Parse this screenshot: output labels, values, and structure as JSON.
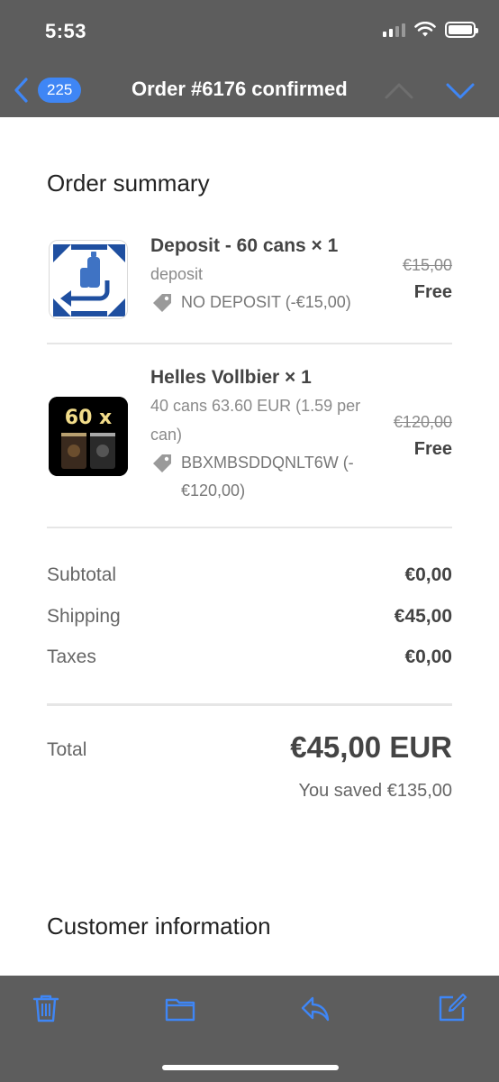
{
  "status_bar": {
    "time": "5:53"
  },
  "nav": {
    "badge": "225",
    "title": "Order #6176 confirmed"
  },
  "order_summary": {
    "title": "Order summary",
    "items": [
      {
        "name": "Deposit - 60 cans × 1",
        "subtitle": "deposit",
        "discount": "NO DEPOSIT (-€15,00)",
        "original_price": "€15,00",
        "price": "Free",
        "icon": "return-bottle-icon"
      },
      {
        "name": "Helles Vollbier × 1",
        "subtitle": "40 cans 63.60 EUR (1.59 per can)",
        "discount": "BBXMBSDDQNLT6W (-€120,00)",
        "original_price": "€120,00",
        "price": "Free",
        "thumb_text": "60 x"
      }
    ]
  },
  "totals": {
    "rows": [
      {
        "label": "Subtotal",
        "value": "€0,00"
      },
      {
        "label": "Shipping",
        "value": "€45,00"
      },
      {
        "label": "Taxes",
        "value": "€0,00"
      }
    ],
    "total_label": "Total",
    "total_value": "€45,00 EUR",
    "saved": "You saved €135,00"
  },
  "customer_information": {
    "title": "Customer information"
  },
  "colors": {
    "accent": "#3f86f5",
    "bar_background": "#5d5d5d",
    "deposit_blue": "#1f4fa0"
  },
  "toolbar": {
    "icons": [
      "trash-icon",
      "folder-icon",
      "reply-icon",
      "compose-icon"
    ]
  }
}
